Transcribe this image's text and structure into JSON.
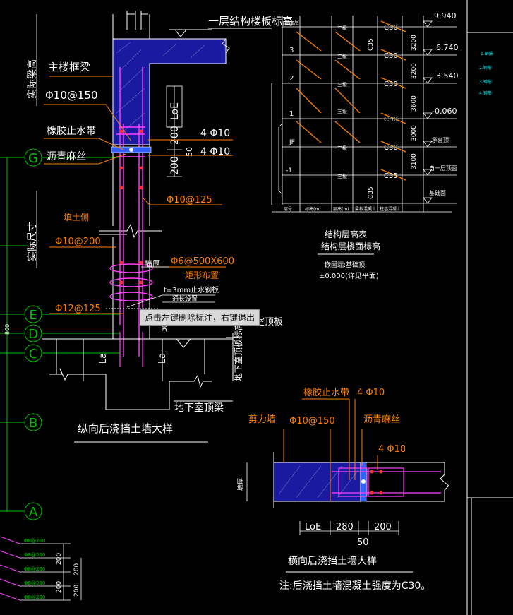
{
  "labels": {
    "slab_level": "一层结构楼板标高",
    "frame_beam": "主楼框梁",
    "actual_beam_height": "实际梁高",
    "stirrup_150": "Φ10@150",
    "loe": "LoE",
    "rubber_waterstop": "橡胶止水带",
    "asphalt_hemp": "沥青麻丝",
    "dim_200_a": "200",
    "dim_200_b": "200",
    "dim_50": "50",
    "bar_4phi10_a": "4 Φ10",
    "bar_4phi10_b": "4 Φ10",
    "stirrup_125": "Φ10@125",
    "fill_side": "填土侧",
    "stirrup_200": "Φ10@200",
    "actual_size": "实际尺寸",
    "wall_thickness": "墙厚",
    "tie_bar": "Φ6@500X600",
    "rect_layout": "矩形布置",
    "steel_plate": "t=3mm止水钢板",
    "steel_plate_note": "通长设置",
    "bar_12_125": "Φ12@125",
    "basement_roof_slab": "地下室顶板",
    "basement_roof_level": "地下室顶板标高",
    "basement_roof_beam": "地下室顶梁",
    "la_1": "La",
    "la_2": "La",
    "dim_300": "300",
    "longitudinal_title": "纵向后浇挡土墙大样",
    "shear_wall": "剪力墙",
    "rubber_waterstop_2": "橡胶止水带",
    "bar_4phi10_c": "4 Φ10",
    "stirrup_150_b": "Φ10@150",
    "asphalt_hemp_2": "沥青麻丝",
    "bar_4phi18": "4 Φ18",
    "wall_thick_2": "墙厚",
    "dim_loe": "LoE",
    "dim_280": "280",
    "dim_200_c": "200",
    "dim_50_b": "50",
    "transverse_title": "横向后浇挡土墙大样",
    "note": "注:后浇挡土墙混凝土强度为C30。",
    "table_title": "结构层高表",
    "table_subtitle": "结构层楼面标高",
    "table_note1": "嵌固端:基础顶",
    "table_note2": "±0.000(详见平面)",
    "axis_g": "G",
    "axis_e": "E",
    "axis_d": "D",
    "axis_c": "C",
    "axis_b": "B",
    "axis_a": "A",
    "left_num": "800"
  },
  "table": {
    "levels": [
      "9.940",
      "6.740",
      "3.540",
      "-0.060",
      "承台顶",
      "自一层顶面",
      "基础面"
    ],
    "heights": [
      "3200",
      "3200",
      "3600",
      "3000",
      "3100"
    ],
    "floors": [
      "屋面层",
      "3",
      "2",
      "1",
      "JF",
      "-1"
    ],
    "grades": [
      "C30",
      "C30",
      "C30",
      "C30",
      "C30",
      "C35",
      "C35",
      "C35"
    ],
    "seismic": [
      "三级",
      "三级",
      "三级",
      "三级",
      "三级",
      "三级"
    ],
    "col_headers": [
      "层号",
      "标高(m)",
      "层高(m)",
      "梁板混凝土",
      "柱墙混凝土"
    ]
  },
  "bottom_left": {
    "items": [
      "Φ8@200",
      "Φ8@200",
      "Φ8@200",
      "Φ8@200",
      "Φ8@200"
    ],
    "dims": [
      "200",
      "200",
      "200",
      "200"
    ]
  },
  "right_panel": {
    "lines": [
      "1.钢筋",
      "2.钢筋",
      "3.钢筋",
      "4.钢筋"
    ]
  },
  "tooltip": "点击左键删除标注，右键退出"
}
